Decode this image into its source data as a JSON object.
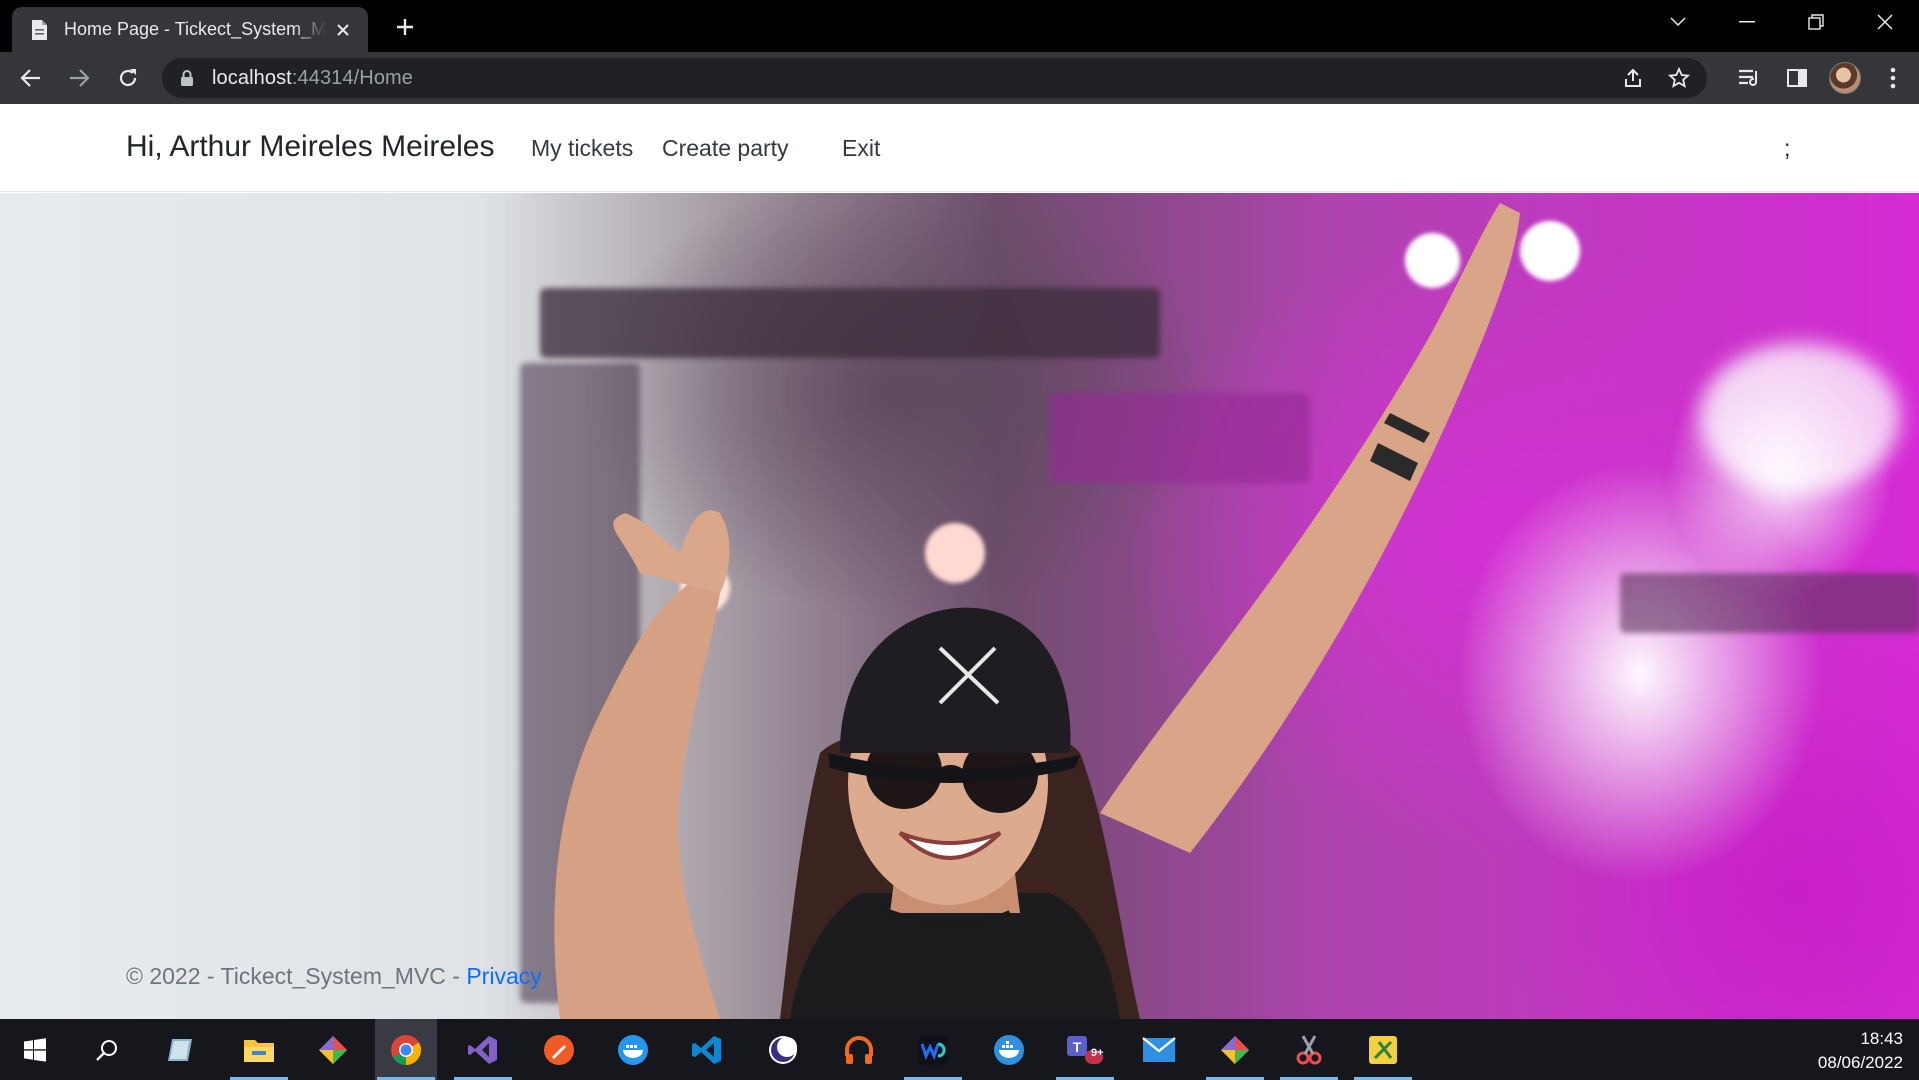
{
  "browser": {
    "tab_title": "Home Page - Tickect_System_MVC",
    "url_host": "localhost",
    "url_path": ":44314/Home"
  },
  "navbar": {
    "brand": "Hi, Arthur Meireles Meireles",
    "links": [
      "My tickets",
      "Create party",
      "Exit"
    ],
    "trailing": ";"
  },
  "footer": {
    "text": "© 2022 - Tickect_System_MVC - ",
    "link": "Privacy"
  },
  "taskbar": {
    "apps": [
      "start-icon",
      "search-icon",
      "notes-app-icon",
      "file-explorer-icon",
      "git-icon",
      "chrome-icon",
      "visual-studio-icon",
      "postman-icon",
      "docker-icon",
      "vscode-icon",
      "eclipse-icon",
      "headphones-app-icon",
      "webstorm-icon",
      "docker-desktop-icon",
      "teams-icon",
      "mail-icon",
      "git-extensions-icon",
      "snipping-tool-icon",
      "sketch-app-icon"
    ],
    "teams_badge": "9+",
    "time": "18:43",
    "date": "08/06/2022"
  },
  "colors": {
    "chrome_dark": "#35363a",
    "link_blue": "#0d6efd",
    "stage_magenta": "#d62bd6"
  }
}
